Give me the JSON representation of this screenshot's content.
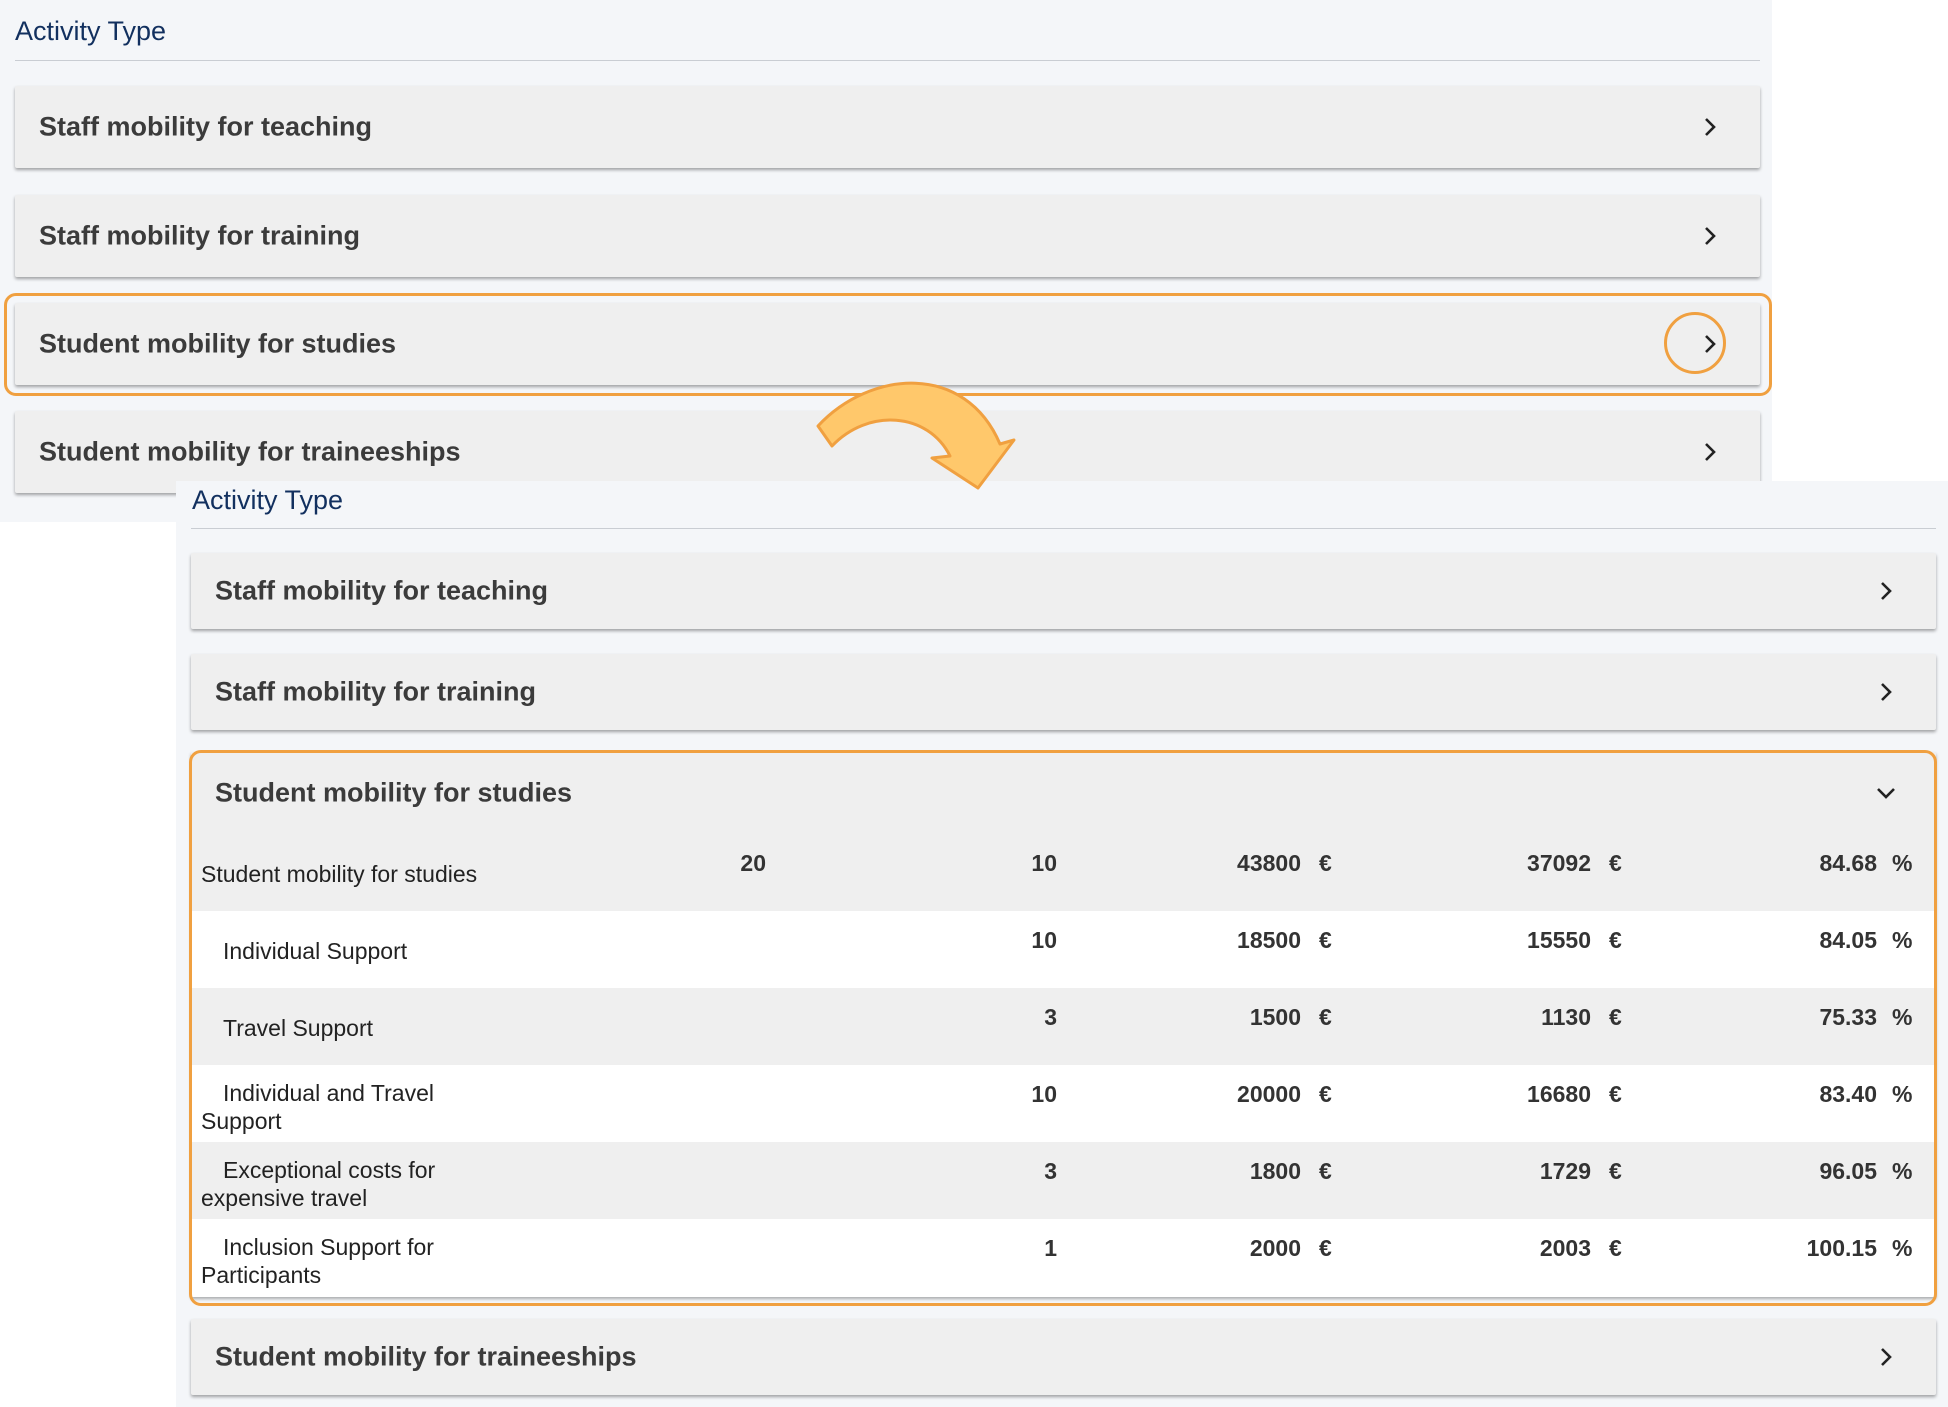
{
  "colors": {
    "highlight": "#f0a040",
    "arrow_fill": "#ffc86b",
    "title_color": "#12305f",
    "accordion_bg": "#efefef"
  },
  "top_panel": {
    "title": "Activity Type",
    "items": [
      {
        "label": "Staff mobility for teaching",
        "icon": "chevron-right-icon"
      },
      {
        "label": "Staff mobility for training",
        "icon": "chevron-right-icon"
      },
      {
        "label": "Student mobility for studies",
        "icon": "chevron-right-icon"
      },
      {
        "label": "Student mobility for traineeships",
        "icon": "chevron-right-icon"
      }
    ]
  },
  "bottom_panel": {
    "title": "Activity Type",
    "items": [
      {
        "label": "Staff mobility for teaching",
        "icon": "chevron-right-icon"
      },
      {
        "label": "Staff mobility for training",
        "icon": "chevron-right-icon"
      }
    ],
    "expanded": {
      "label": "Student mobility for studies",
      "icon": "chevron-down-icon",
      "summary": {
        "label": "Student mobility for studies",
        "col1": "20",
        "col2": "10",
        "col3": "43800",
        "col3_unit": "€",
        "col4": "37092",
        "col4_unit": "€",
        "col5": "84.68",
        "col5_unit": "%"
      },
      "rows": [
        {
          "label_line1": "Individual Support",
          "label_line2": "",
          "col2": "10",
          "col3": "18500",
          "col3_unit": "€",
          "col4": "15550",
          "col4_unit": "€",
          "col5": "84.05",
          "col5_unit": "%"
        },
        {
          "label_line1": "Travel Support",
          "label_line2": "",
          "col2": "3",
          "col3": "1500",
          "col3_unit": "€",
          "col4": "1130",
          "col4_unit": "€",
          "col5": "75.33",
          "col5_unit": "%"
        },
        {
          "label_line1": "Individual and Travel",
          "label_line2": "Support",
          "col2": "10",
          "col3": "20000",
          "col3_unit": "€",
          "col4": "16680",
          "col4_unit": "€",
          "col5": "83.40",
          "col5_unit": "%"
        },
        {
          "label_line1": "Exceptional costs for",
          "label_line2": "expensive travel",
          "col2": "3",
          "col3": "1800",
          "col3_unit": "€",
          "col4": "1729",
          "col4_unit": "€",
          "col5": "96.05",
          "col5_unit": "%"
        },
        {
          "label_line1": "Inclusion Support for",
          "label_line2": "Participants",
          "col2": "1",
          "col3": "2000",
          "col3_unit": "€",
          "col4": "2003",
          "col4_unit": "€",
          "col5": "100.15",
          "col5_unit": "%"
        }
      ]
    },
    "after": {
      "label": "Student mobility for traineeships",
      "icon": "chevron-right-icon"
    }
  }
}
